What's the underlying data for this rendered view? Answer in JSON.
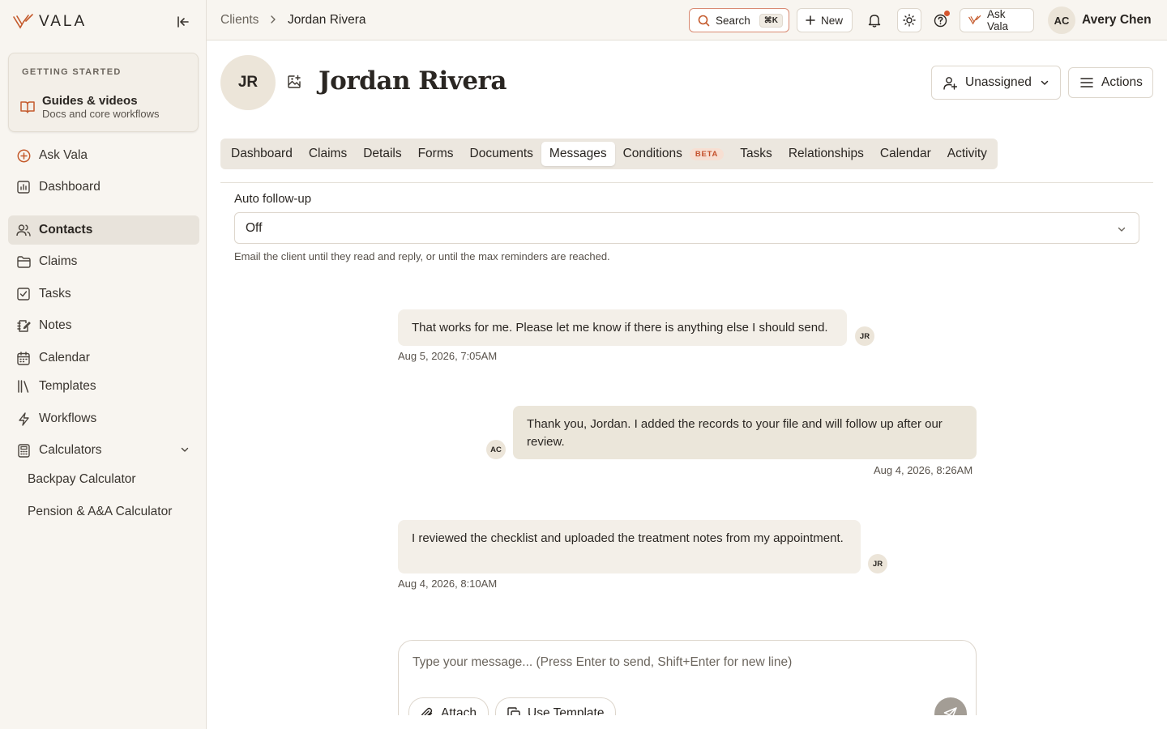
{
  "brand": {
    "name": "VALA"
  },
  "sidebar": {
    "getting_started": {
      "heading": "GETTING STARTED",
      "title": "Guides & videos",
      "subtitle": "Docs and core workflows"
    },
    "items": [
      {
        "label": "Ask Vala",
        "icon": "plus-circle-icon"
      },
      {
        "label": "Dashboard",
        "icon": "chart-icon"
      },
      {
        "label": "Contacts",
        "icon": "users-icon",
        "active": true
      },
      {
        "label": "Claims",
        "icon": "folder-icon"
      },
      {
        "label": "Tasks",
        "icon": "checkbox-icon"
      },
      {
        "label": "Notes",
        "icon": "notes-icon"
      },
      {
        "label": "Calendar",
        "icon": "calendar-icon"
      },
      {
        "label": "Templates",
        "icon": "library-icon"
      },
      {
        "label": "Workflows",
        "icon": "lightning-icon"
      },
      {
        "label": "Calculators",
        "icon": "calculator-icon"
      }
    ],
    "calculators": [
      "Backpay Calculator",
      "Pension & A&A Calculator"
    ]
  },
  "topbar": {
    "breadcrumb": {
      "parent": "Clients",
      "current": "Jordan Rivera"
    },
    "search_label": "Search",
    "search_shortcut": "⌘K",
    "new_label": "New",
    "ask_vala_label": "Ask Vala",
    "user": {
      "initials": "AC",
      "name": "Avery Chen"
    }
  },
  "client": {
    "initials": "JR",
    "name": "Jordan Rivera",
    "assignee": "Unassigned",
    "actions_label": "Actions"
  },
  "tabs": [
    {
      "label": "Dashboard"
    },
    {
      "label": "Claims"
    },
    {
      "label": "Details"
    },
    {
      "label": "Forms"
    },
    {
      "label": "Documents"
    },
    {
      "label": "Messages",
      "active": true
    },
    {
      "label": "Conditions",
      "badge": "BETA"
    },
    {
      "label": "Tasks"
    },
    {
      "label": "Relationships"
    },
    {
      "label": "Calendar"
    },
    {
      "label": "Activity"
    }
  ],
  "auto_follow_up": {
    "label": "Auto follow-up",
    "value": "Off",
    "help": "Email the client until they read and reply, or until the max reminders are reached."
  },
  "messages": [
    {
      "direction": "in",
      "author": "JR",
      "text": "That works for me. Please let me know if there is anything else I should send.",
      "time": "Aug 5, 2026, 7:05AM"
    },
    {
      "direction": "out",
      "author": "AC",
      "text": "Thank you, Jordan. I added the records to your file and will follow up after our review.",
      "time": "Aug 4, 2026, 8:26AM"
    },
    {
      "direction": "in",
      "author": "JR",
      "text": "I reviewed the checklist and uploaded the treatment notes from my appointment.",
      "time": "Aug 4, 2026, 8:10AM"
    }
  ],
  "composer": {
    "placeholder": "Type your message... (Press Enter to send, Shift+Enter for new line)",
    "attach_label": "Attach",
    "template_label": "Use Template"
  },
  "colors": {
    "accent": "#c45a2c",
    "sidebar_bg": "#f8f5f0",
    "bubble_out": "#ebe6da",
    "bubble_in": "#f3efe8"
  }
}
